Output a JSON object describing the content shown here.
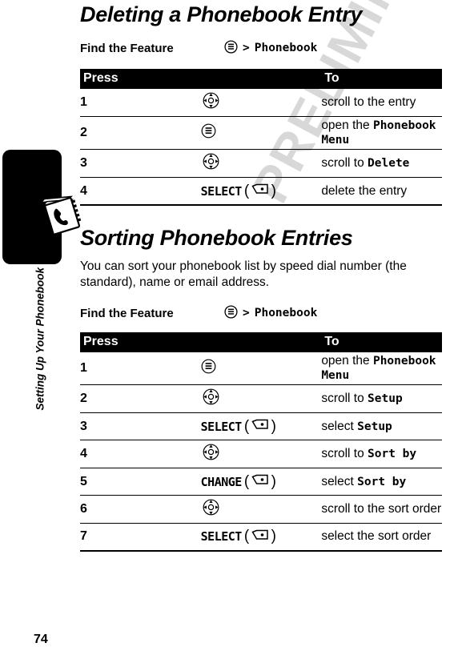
{
  "page": {
    "number": "74",
    "watermark": "PRELIMINARY",
    "sidebar_label": "Setting Up Your Phonebook",
    "tab_icon_name": "phonebook-book-icon"
  },
  "sections": [
    {
      "id": "deleting",
      "title": "Deleting a Phonebook Entry",
      "body": "",
      "find_feature": {
        "label": "Find the Feature",
        "menu_icon": "menu-key-icon",
        "separator": ">",
        "path": "Phonebook"
      },
      "table": {
        "headers": {
          "press": "Press",
          "to": "To"
        },
        "rows": [
          {
            "num": "1",
            "key_type": "nav",
            "key_icon": "navigation-key-icon",
            "key_label": "",
            "desc_prefix": "scroll to the entry",
            "desc_mono": "",
            "desc_suffix": ""
          },
          {
            "num": "2",
            "key_type": "menu",
            "key_icon": "menu-key-icon",
            "key_label": "",
            "desc_prefix": "open the ",
            "desc_mono": "Phonebook Menu",
            "desc_suffix": ""
          },
          {
            "num": "3",
            "key_type": "nav",
            "key_icon": "navigation-key-icon",
            "key_label": "",
            "desc_prefix": "scroll to ",
            "desc_mono": "Delete",
            "desc_suffix": ""
          },
          {
            "num": "4",
            "key_type": "softkey",
            "key_icon": "softkey-icon",
            "key_label": "SELECT",
            "desc_prefix": "delete the entry",
            "desc_mono": "",
            "desc_suffix": ""
          }
        ]
      }
    },
    {
      "id": "sorting",
      "title": "Sorting Phonebook Entries",
      "body": "You can sort your phonebook list by speed dial number (the standard), name or email address.",
      "find_feature": {
        "label": "Find the Feature",
        "menu_icon": "menu-key-icon",
        "separator": ">",
        "path": "Phonebook"
      },
      "table": {
        "headers": {
          "press": "Press",
          "to": "To"
        },
        "rows": [
          {
            "num": "1",
            "key_type": "menu",
            "key_icon": "menu-key-icon",
            "key_label": "",
            "desc_prefix": "open the ",
            "desc_mono": "Phonebook Menu",
            "desc_suffix": ""
          },
          {
            "num": "2",
            "key_type": "nav",
            "key_icon": "navigation-key-icon",
            "key_label": "",
            "desc_prefix": "scroll to ",
            "desc_mono": "Setup",
            "desc_suffix": ""
          },
          {
            "num": "3",
            "key_type": "softkey",
            "key_icon": "softkey-icon",
            "key_label": "SELECT",
            "desc_prefix": "select ",
            "desc_mono": "Setup",
            "desc_suffix": ""
          },
          {
            "num": "4",
            "key_type": "nav",
            "key_icon": "navigation-key-icon",
            "key_label": "",
            "desc_prefix": "scroll to ",
            "desc_mono": "Sort by",
            "desc_suffix": ""
          },
          {
            "num": "5",
            "key_type": "softkey",
            "key_icon": "softkey-icon",
            "key_label": "CHANGE",
            "desc_prefix": "select ",
            "desc_mono": "Sort by",
            "desc_suffix": ""
          },
          {
            "num": "6",
            "key_type": "nav",
            "key_icon": "navigation-key-icon",
            "key_label": "",
            "desc_prefix": "scroll to the sort order",
            "desc_mono": "",
            "desc_suffix": ""
          },
          {
            "num": "7",
            "key_type": "softkey",
            "key_icon": "softkey-icon",
            "key_label": "SELECT",
            "desc_prefix": "select the sort order",
            "desc_mono": "",
            "desc_suffix": ""
          }
        ]
      }
    }
  ]
}
